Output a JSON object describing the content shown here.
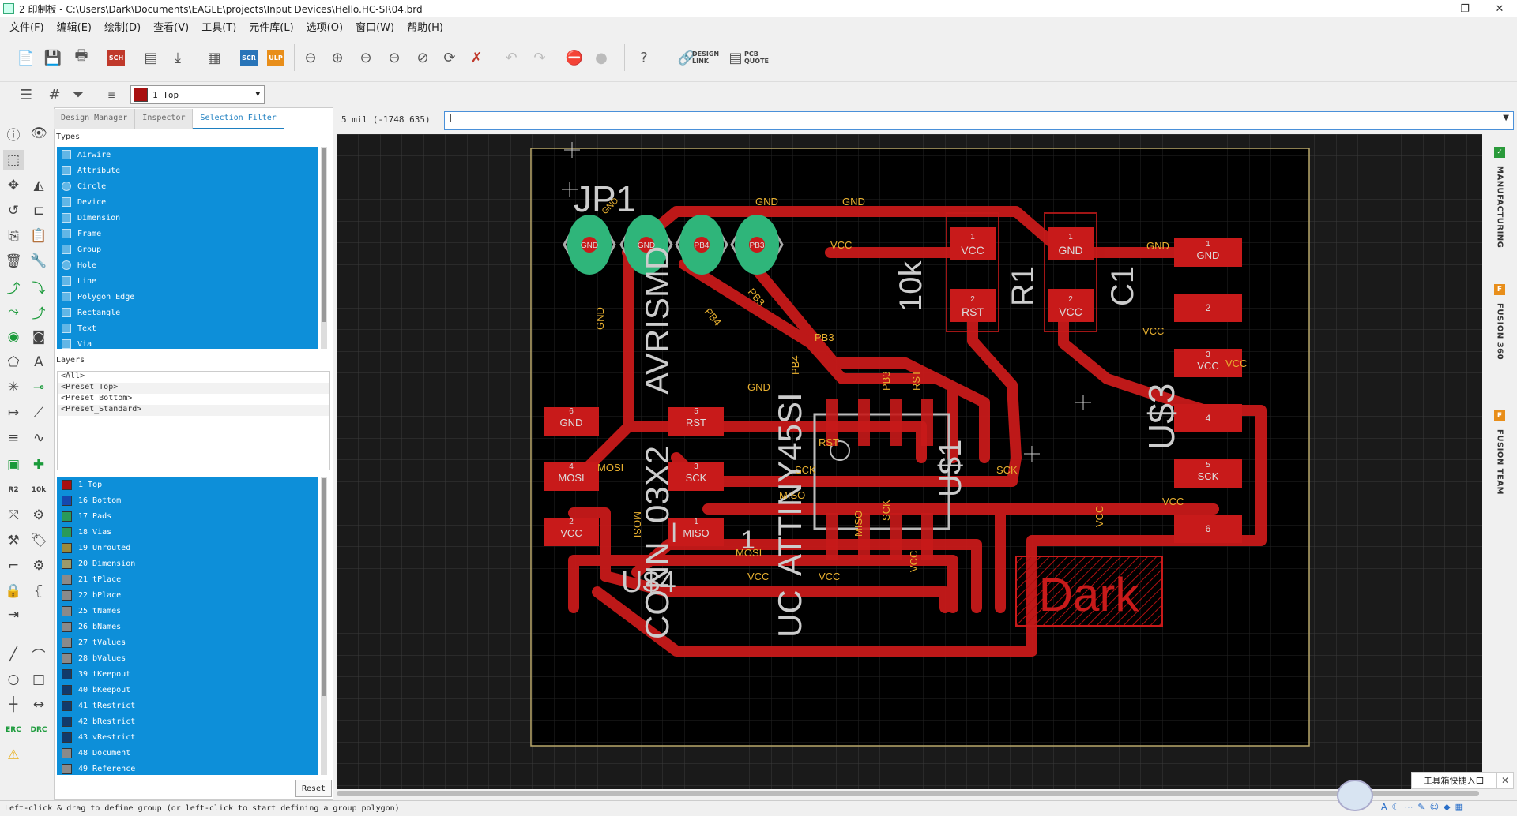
{
  "window": {
    "title": "2 印制板 - C:\\Users\\Dark\\Documents\\EAGLE\\projects\\Input Devices\\Hello.HC-SR04.brd",
    "controls": [
      "—",
      "❐",
      "✕"
    ]
  },
  "menu": [
    "文件(F)",
    "编辑(E)",
    "绘制(D)",
    "查看(V)",
    "工具(T)",
    "元件库(L)",
    "选项(O)",
    "窗口(W)",
    "帮助(H)"
  ],
  "toolbar": {
    "sch_label": "SCH",
    "scr_label": "SCR",
    "ulp_label": "ULP",
    "design_link": "DESIGN\nLINK",
    "pcb_quote": "PCB\nQUOTE"
  },
  "layer_combo": {
    "value": "1 Top",
    "color": "#a81010"
  },
  "panel": {
    "tabs": [
      "Design Manager",
      "Inspector",
      "Selection Filter"
    ],
    "active_tab": 2,
    "types_label": "Types",
    "types": [
      "Airwire",
      "Attribute",
      "Circle",
      "Device",
      "Dimension",
      "Frame",
      "Group",
      "Hole",
      "Line",
      "Polygon Edge",
      "Rectangle",
      "Text",
      "Via"
    ],
    "layers_label": "Layers",
    "presets": [
      "<All>",
      "<Preset_Top>",
      "<Preset_Bottom>",
      "<Preset_Standard>"
    ],
    "layers": [
      {
        "name": "1 Top",
        "color": "#a81010"
      },
      {
        "name": "16 Bottom",
        "color": "#1448b0"
      },
      {
        "name": "17 Pads",
        "color": "#2a9a5a"
      },
      {
        "name": "18 Vias",
        "color": "#2a9a5a"
      },
      {
        "name": "19 Unrouted",
        "color": "#9a8a3a"
      },
      {
        "name": "20 Dimension",
        "color": "#9a9a6a"
      },
      {
        "name": "21 tPlace",
        "color": "#8a8a8a"
      },
      {
        "name": "22 bPlace",
        "color": "#8a8a8a"
      },
      {
        "name": "25 tNames",
        "color": "#8a8a8a"
      },
      {
        "name": "26 bNames",
        "color": "#8a8a8a"
      },
      {
        "name": "27 tValues",
        "color": "#8a8a8a"
      },
      {
        "name": "28 bValues",
        "color": "#8a8a8a"
      },
      {
        "name": "39 tKeepout",
        "color": "#123a6a"
      },
      {
        "name": "40 bKeepout",
        "color": "#123a6a"
      },
      {
        "name": "41 tRestrict",
        "color": "#123a6a"
      },
      {
        "name": "42 bRestrict",
        "color": "#123a6a"
      },
      {
        "name": "43 vRestrict",
        "color": "#123a6a"
      },
      {
        "name": "48 Document",
        "color": "#8a8a8a"
      },
      {
        "name": "49 Reference",
        "color": "#8a8a8a"
      }
    ],
    "reset": "Reset"
  },
  "command": {
    "coord": "5 mil (-1748 635)",
    "value": "|"
  },
  "board": {
    "jp1_label": "JP1",
    "avrismd": "AVRISMD",
    "conn": "CONN_03X2",
    "attiny": "ATTINY45SI",
    "uc": "UC",
    "us1": "U$1",
    "us3": "U$3",
    "us4": "U$4",
    "r1": "R1",
    "r_value": "10k",
    "c1": "C1",
    "one": "1",
    "dark": "Dark",
    "net_gnd": "GND",
    "net_vcc": "VCC",
    "net_rst": "RST",
    "net_sck": "SCK",
    "net_miso": "MISO",
    "net_mosi": "MOSI",
    "net_pb3": "PB3",
    "net_pb4": "PB4",
    "pad_1": "1",
    "pad_2": "2",
    "pad_3": "3",
    "pad_4": "4",
    "pad_5": "5",
    "pad_6": "6",
    "jp_pins": [
      "GND",
      "GND",
      "PB4",
      "PB3"
    ],
    "jp_pin_top": [
      "GND",
      "GND",
      "PB4",
      "PB3"
    ]
  },
  "right_panel": [
    "MANUFACTURING",
    "FUSION 360",
    "FUSION TEAM"
  ],
  "status": "Left-click & drag to define group (or left-click to start defining a group polygon)",
  "popup": "工具箱快捷入口"
}
